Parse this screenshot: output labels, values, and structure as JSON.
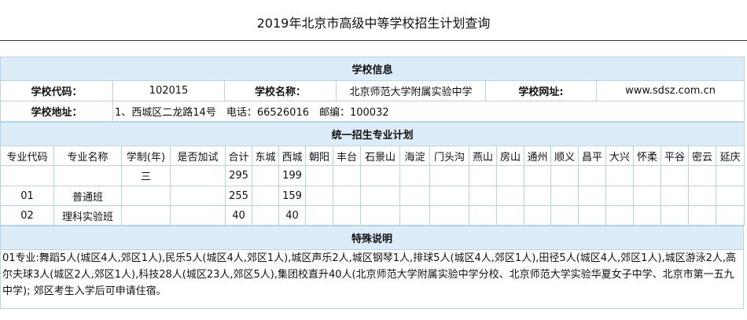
{
  "page_title": "2019年北京市高级中等学校招生计划查询",
  "school_info": {
    "section_title": "学校信息",
    "code_label": "学校代码：",
    "code": "102015",
    "name_label": "学校名称：",
    "name": "北京师范大学附属实验中学",
    "url_label": "学校网址:",
    "url": "www.sdsz.com.cn",
    "address_label": "学校地址：",
    "address": "1、西城区二龙路14号　电话：66526016　邮编：100032"
  },
  "plan": {
    "section_title": "统一招生专业计划",
    "headers": [
      "专业代码",
      "专业名称",
      "学制(年)",
      "是否加试",
      "合计",
      "东城",
      "西城",
      "朝阳",
      "丰台",
      "石景山",
      "海淀",
      "门头沟",
      "燕山",
      "房山",
      "通州",
      "顺义",
      "昌平",
      "大兴",
      "怀柔",
      "平谷",
      "密云",
      "延庆"
    ],
    "rows": [
      [
        "",
        "",
        "三",
        "",
        "295",
        "",
        "199",
        "",
        "",
        "",
        "",
        "",
        "",
        "",
        "",
        "",
        "",
        "",
        "",
        "",
        "",
        ""
      ],
      [
        "01",
        "普通班",
        "",
        "",
        "255",
        "",
        "159",
        "",
        "",
        "",
        "",
        "",
        "",
        "",
        "",
        "",
        "",
        "",
        "",
        "",
        "",
        ""
      ],
      [
        "02",
        "理科实验班",
        "",
        "",
        "40",
        "",
        "40",
        "",
        "",
        "",
        "",
        "",
        "",
        "",
        "",
        "",
        "",
        "",
        "",
        "",
        "",
        ""
      ]
    ]
  },
  "notes": {
    "section_title": "特殊说明",
    "text": "01专业:舞蹈5人(城区4人,郊区1人),民乐5人(城区4人,郊区1人),城区声乐2人,城区钢琴1人,排球5人(城区4人,郊区1人),田径5人(城区4人,郊区1人),城区游泳2人,高尔夫球3人(城区2人,郊区1人),科技28人(城区23人,郊区5人),集团校直升40人(北京师范大学附属实验中学分校、北京师范大学实验华夏女子中学、北京市第一五九中学); 郊区考生入学后可申请住宿。"
  }
}
